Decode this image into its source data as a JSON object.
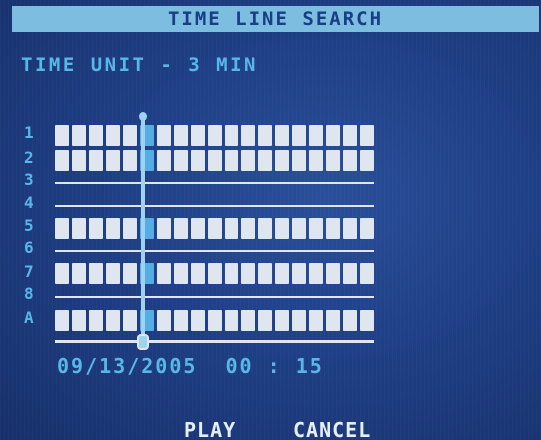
{
  "title": "TIME LINE SEARCH",
  "time_unit": "TIME UNIT - 3 MIN",
  "channels": [
    {
      "label": "1",
      "has_recording": true
    },
    {
      "label": "2",
      "has_recording": true
    },
    {
      "label": "3",
      "has_recording": false
    },
    {
      "label": "4",
      "has_recording": false
    },
    {
      "label": "5",
      "has_recording": true
    },
    {
      "label": "6",
      "has_recording": false
    },
    {
      "label": "7",
      "has_recording": true
    },
    {
      "label": "8",
      "has_recording": false
    },
    {
      "label": "A",
      "has_recording": true
    }
  ],
  "timeline": {
    "blocks_per_row": 19,
    "current_block": 5
  },
  "datetime": "09/13/2005  00 : 15",
  "buttons": {
    "play": "PLAY",
    "cancel": "CANCEL"
  },
  "colors": {
    "background": "#1f3f86",
    "title_bar": "#7cbde0",
    "title_text": "#183e85",
    "label_text": "#57b8e8",
    "block": "#dfe6f0",
    "current_block": "#54aee3"
  }
}
